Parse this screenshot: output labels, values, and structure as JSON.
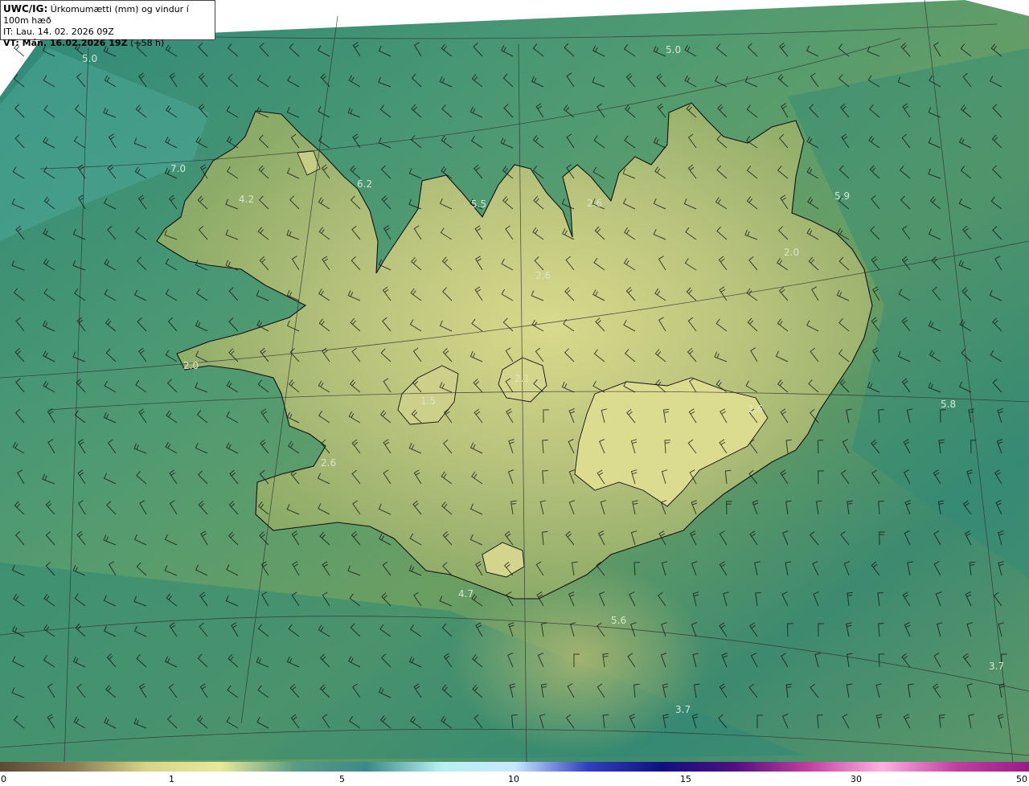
{
  "header": {
    "product_bold": "UWC/IG:",
    "product_desc": " Úrkomumætti (mm) og vindur í 100m hæð",
    "issue_time": "IT: Lau. 14. 02. 2026 09Z",
    "valid_prefix": "VT: Mán. 16.02.2026 19Z",
    "valid_suffix": " (+58 h)"
  },
  "value_labels": [
    "5.0",
    "5.0",
    "7.0",
    "4.2",
    "6.2",
    "5.5",
    "2.6",
    "5.9",
    "2.6",
    "2.0",
    "2.0",
    "2.1",
    "1.5",
    "5.8",
    "1.6",
    "2.6",
    "4.7",
    "5.6",
    "3.7",
    "3.7"
  ],
  "colorbar": {
    "ticks": [
      "0",
      "1",
      "5",
      "10",
      "15",
      "30",
      "50"
    ],
    "colors": [
      "#5b4a35",
      "#8a7a55",
      "#d8d58a",
      "#e8e89a",
      "#5a9c84",
      "#3a8a8a",
      "#b8f0f0",
      "#c8e8ff",
      "#3040c0",
      "#101080",
      "#501080",
      "#c040a0",
      "#ffb0e0",
      "#c040a0",
      "#9a1a8a"
    ]
  },
  "colors": {
    "ocean_dark": "#2f8a7a",
    "ocean_light": "#6fa56a",
    "land_low": "#8fb06a",
    "land_high": "#d6d98a",
    "coast": "#111111"
  }
}
